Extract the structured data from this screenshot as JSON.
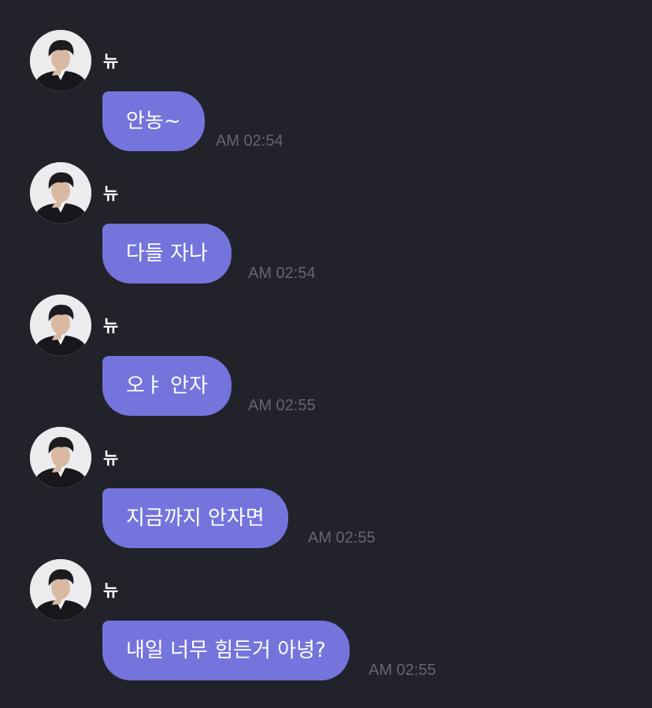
{
  "messages": [
    {
      "sender": "뉴",
      "text": "안농~",
      "time": "AM 02:54"
    },
    {
      "sender": "뉴",
      "text": "다들 자나",
      "time": "AM 02:54"
    },
    {
      "sender": "뉴",
      "text": "오ㅑ 안자",
      "time": "AM 02:55"
    },
    {
      "sender": "뉴",
      "text": "지금까지 안자면",
      "time": "AM 02:55"
    },
    {
      "sender": "뉴",
      "text": "내일 너무 힘든거 아녕?",
      "time": "AM 02:55"
    }
  ],
  "colors": {
    "background": "#22222a",
    "bubble": "#7474dc",
    "timestamp": "#66666f",
    "text": "#ffffff"
  },
  "icons": {
    "avatar": "profile-photo"
  }
}
